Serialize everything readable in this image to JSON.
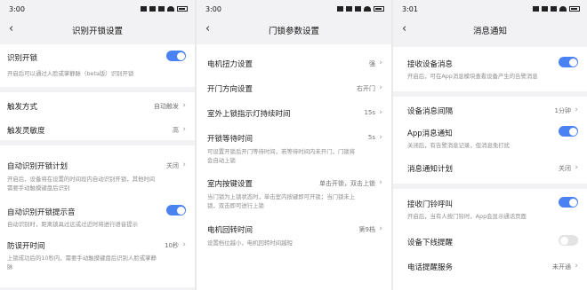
{
  "accent_color": "#4a82f3",
  "screen1": {
    "time": "3:00",
    "title": "识别开锁设置",
    "unlock": {
      "label": "识别开锁",
      "desc": "开启后可以通过人脸或掌静脉（beta版）识别开锁",
      "enabled": true
    },
    "trigger_mode": {
      "label": "触发方式",
      "value": "自动触发"
    },
    "trigger_sensitivity": {
      "label": "触发灵敏度",
      "value": "高"
    },
    "auto_plan": {
      "label": "自动识别开锁计划",
      "value": "关闭",
      "desc_line1": "开启后，设备将在设置的时间段内自动识别开锁，其他时间",
      "desc_line2": "需要手动触摸键盘后识别"
    },
    "auto_tone": {
      "label": "自动识别开锁提示音",
      "desc": "自动识别时，距离锁具过远或过近时将进行语音提示",
      "enabled": true
    },
    "anti_peek": {
      "label": "防误开时间",
      "value": "10秒",
      "desc_line1": "上锁成功后的10秒内，需要手动触摸键盘后识别人脸或掌静",
      "desc_line2": "脉"
    }
  },
  "screen2": {
    "time": "3:00",
    "title": "门锁参数设置",
    "motor_torque": {
      "label": "电机扭力设置",
      "value": "强"
    },
    "open_direction": {
      "label": "开门方向设置",
      "value": "右开门"
    },
    "indicator_time": {
      "label": "室外上锁指示灯持续时间",
      "value": "15s"
    },
    "wait_time": {
      "label": "开锁等待时间",
      "value": "5s",
      "desc_line1": "可设置开锁后开门等待时间，若等待时间内未开门，门锁将",
      "desc_line2": "会自动上锁"
    },
    "indoor_button": {
      "label": "室内按键设置",
      "value": "单击开锁，双击上锁",
      "desc_line1": "当门锁为上锁状态时，单击室内按键即可开锁；当门锁未上",
      "desc_line2": "锁，双击即可进行上锁"
    },
    "motor_return": {
      "label": "电机回转时间",
      "value": "第9档",
      "desc": "设置档位越小，电机回转时间越短"
    }
  },
  "screen3": {
    "time": "3:01",
    "title": "消息通知",
    "receive_msgs": {
      "label": "接收设备消息",
      "desc": "开启后，可在App消息模块查看设备产生的告警消息",
      "enabled": true
    },
    "msg_interval": {
      "label": "设备消息间隔",
      "value": "1分钟"
    },
    "app_notify": {
      "label": "App消息通知",
      "desc_line1": "关闭后，有告警消息记录，但消息免打扰",
      "enabled": true
    },
    "notify_plan": {
      "label": "消息通知计划",
      "value": "关闭"
    },
    "doorbell": {
      "label": "接收门铃呼叫",
      "desc": "开启后，当有人按门铃时，App会显示通话页面",
      "enabled": true
    },
    "offline_remind": {
      "label": "设备下线提醒",
      "enabled": false
    },
    "call_remind": {
      "label": "电话提醒服务",
      "value": "未开通"
    }
  }
}
